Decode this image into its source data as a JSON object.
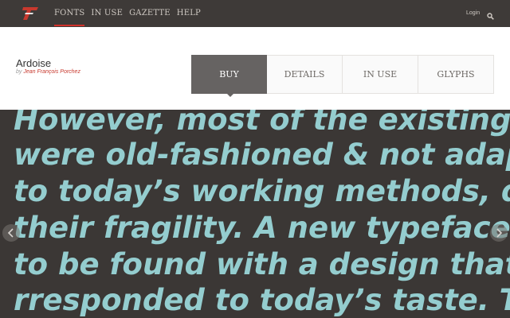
{
  "nav": {
    "items": [
      {
        "label": "FONTS",
        "active": true
      },
      {
        "label": "IN USE",
        "active": false
      },
      {
        "label": "GAZETTE",
        "active": false
      },
      {
        "label": "HELP",
        "active": false
      }
    ],
    "login_label": "Login",
    "search_icon": "search-icon",
    "logo_icon": "logo-icon"
  },
  "font": {
    "name": "Ardoise",
    "by_label": "by",
    "designer": "Jean François Porchez"
  },
  "tabs": [
    {
      "label": "BUY",
      "active": true
    },
    {
      "label": "DETAILS",
      "active": false
    },
    {
      "label": "IN USE",
      "active": false
    },
    {
      "label": "GLYPHS",
      "active": false
    }
  ],
  "specimen": {
    "lines": [
      "However, most of the existing",
      "were old-fashioned & not adapted",
      "to today’s working methods, due",
      "their fragility. A new typeface",
      "to be found with a design that",
      "rresponded to today’s taste. The"
    ]
  },
  "colors": {
    "accent": "#d0302a",
    "designer_link": "#c8392e",
    "specimen_text": "#94cdcf",
    "background": "#3b3735",
    "active_tab": "#666362"
  }
}
